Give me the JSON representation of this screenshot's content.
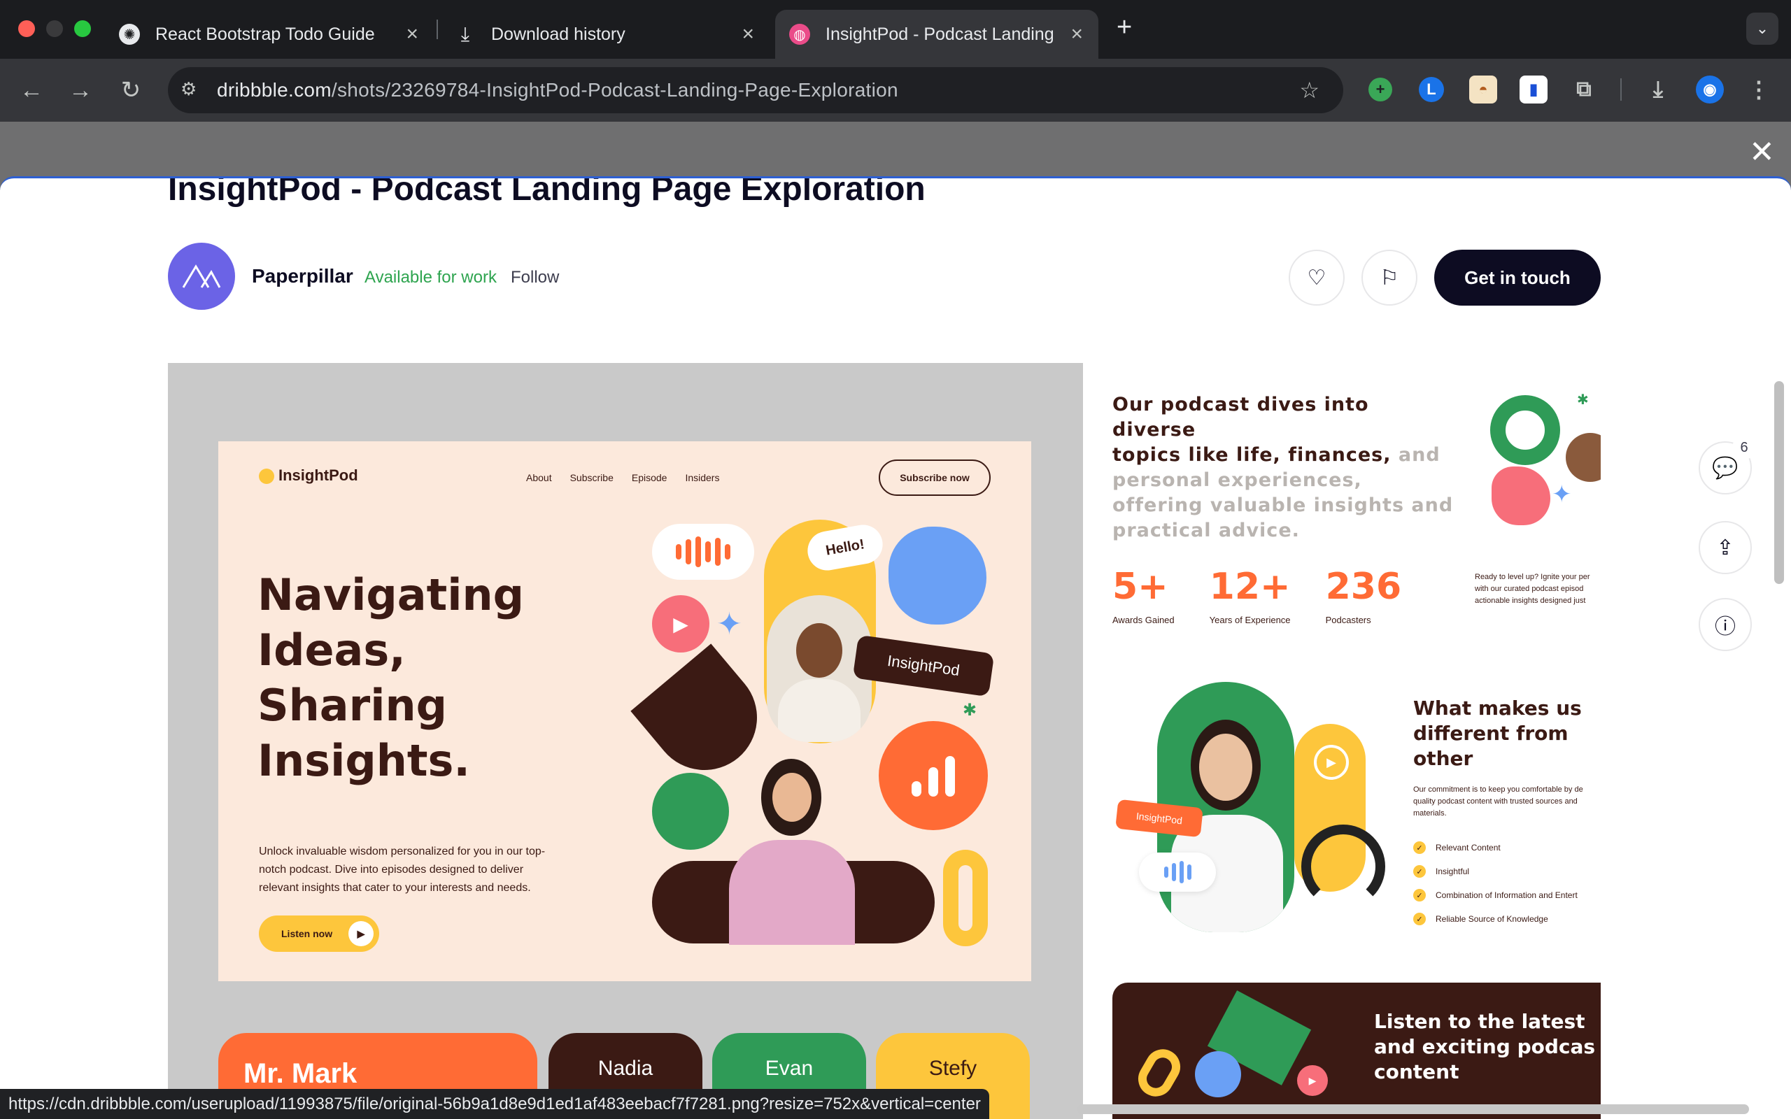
{
  "browser": {
    "tabs": [
      {
        "title": "React Bootstrap Todo Guide",
        "icon": "chatgpt-icon"
      },
      {
        "title": "Download history",
        "icon": "download-icon"
      },
      {
        "title": "InsightPod - Podcast Landing",
        "icon": "dribbble-icon"
      }
    ],
    "url_host": "dribbble.com",
    "url_path": "/shots/23269784-InsightPod-Podcast-Landing-Page-Exploration",
    "status_url": "https://cdn.dribbble.com/userupload/11993875/file/original-56b9a1d8e9d1ed1af483eebacf7f7281.png?resize=752x&vertical=center"
  },
  "shot": {
    "title": "InsightPod - Podcast Landing Page Exploration",
    "author": "Paperpillar",
    "availability": "Available for work",
    "follow_label": "Follow",
    "cta_label": "Get in touch",
    "comment_count": "6"
  },
  "hero": {
    "logo": "InsightPod",
    "nav": [
      "About",
      "Subscribe",
      "Episode",
      "Insiders"
    ],
    "subscribe_label": "Subscribe now",
    "headline": [
      "Navigating",
      "Ideas,",
      "Sharing",
      "Insights."
    ],
    "body": [
      "Unlock invaluable wisdom personalized for you in our top-",
      "notch podcast. Dive into episodes designed to deliver",
      "relevant insights that cater to your interests and needs."
    ],
    "listen_label": "Listen now",
    "bubble_hello": "Hello!",
    "tag_label": "InsightPod"
  },
  "cards": [
    "Mr. Mark",
    "Nadia",
    "Evan",
    "Stefy"
  ],
  "right": {
    "intro_dark": [
      "Our podcast dives into",
      "diverse",
      "topics like life, finances,"
    ],
    "intro_and": "and",
    "intro_light": [
      "personal experiences,",
      "offering valuable insights and",
      "practical advice."
    ],
    "stats": [
      {
        "value": "5+",
        "label": "Awards Gained"
      },
      {
        "value": "12+",
        "label": "Years of Experience"
      },
      {
        "value": "236",
        "label": "Podcasters"
      }
    ],
    "stats_note": [
      "Ready to level up? Ignite your per",
      "with our curated podcast episod",
      "actionable insights designed just"
    ],
    "diff_title": [
      "What makes us",
      "different from",
      "other"
    ],
    "diff_body": [
      "Our commitment is to keep you comfortable by de",
      "quality podcast content with trusted sources and",
      "materials."
    ],
    "diff_items": [
      "Relevant Content",
      "Insightful",
      "Combination of Information and Entert",
      "Reliable Source of Knowledge"
    ],
    "tag_label": "InsightPod",
    "listen_title": [
      "Listen to the latest",
      "and exciting podcas",
      "content"
    ]
  },
  "colors": {
    "accent_orange": "#ff6b35",
    "brand_dark": "#3b1a14",
    "yellow": "#fdc63c",
    "green": "#2f9b57",
    "available_green": "#2ea44f"
  }
}
